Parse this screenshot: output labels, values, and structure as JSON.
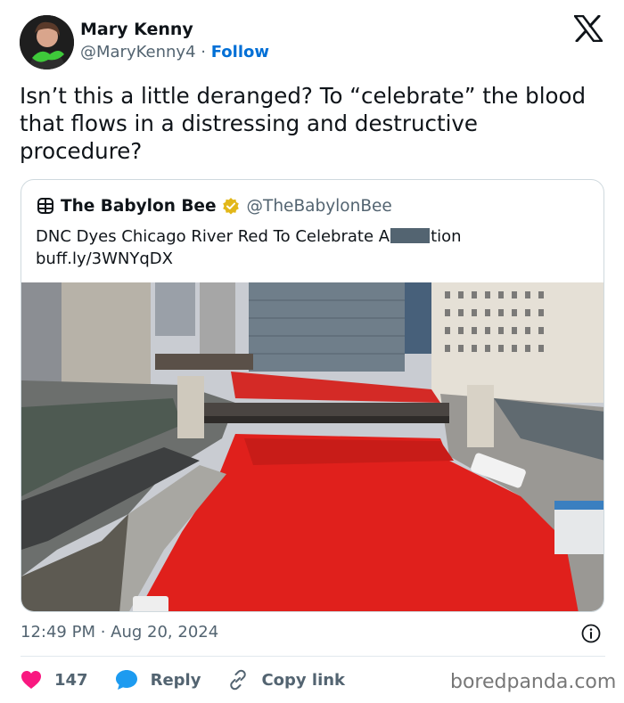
{
  "author": {
    "name": "Mary Kenny",
    "handle": "@MaryKenny4",
    "separator": "·",
    "follow_label": "Follow"
  },
  "tweet_text": "Isn’t this a little deranged? To “celebrate” the blood that flows in a distressing and destructive procedure?",
  "quoted": {
    "name": "The Babylon Bee",
    "handle": "@TheBabylonBee",
    "text_before": "DNC Dyes Chicago River Red To Celebrate A",
    "text_after": "tion",
    "link": "buff.ly/3WNYqDX"
  },
  "timestamp": "12:49 PM · Aug 20, 2024",
  "actions": {
    "likes": "147",
    "reply": "Reply",
    "copy_link": "Copy link"
  },
  "watermark": "boredpanda.com",
  "colors": {
    "follow_blue": "#006fd6",
    "like_red": "#f91880",
    "reply_blue": "#1d9bf0",
    "badge_gold": "#e2b719",
    "river_red": "#e0201c"
  },
  "icons": [
    "x-logo-icon",
    "bee-logo-icon",
    "verified-badge-icon",
    "info-icon",
    "heart-icon",
    "reply-bubble-icon",
    "link-icon"
  ]
}
